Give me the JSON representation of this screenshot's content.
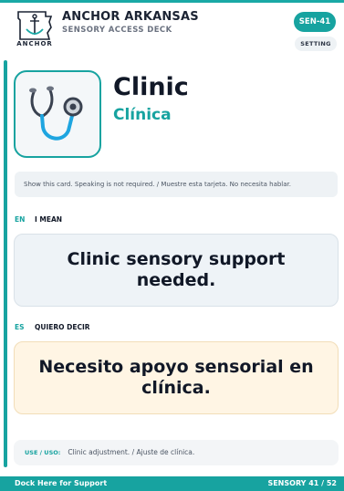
{
  "header": {
    "brand": "ANCHOR ARKANSAS",
    "subbrand": "SENSORY ACCESS DECK",
    "logo_text": "ANCHOR",
    "logo_icon": "arkansas-anchor-logo-icon",
    "card_code": "SEN-41",
    "category": "SETTING"
  },
  "hero": {
    "icon": "stethoscope-icon",
    "title_en": "Clinic",
    "title_es": "Clínica"
  },
  "note": "Show this card. Speaking is not required. / Muestre esta tarjeta. No necesita hablar.",
  "english": {
    "code": "EN",
    "label": "I MEAN",
    "text": "Clinic sensory support needed."
  },
  "spanish": {
    "code": "ES",
    "label": "QUIERO DECIR",
    "text": "Necesito apoyo sensorial en clínica."
  },
  "use": {
    "label": "USE / USO:",
    "text": "Clinic adjustment. / Ajuste de clínica."
  },
  "footer": {
    "left": "Dock Here for Support",
    "right": "SENSORY 41 / 52"
  },
  "colors": {
    "accent": "#17a3a0",
    "english_card": "#eef3f7",
    "spanish_card": "#fff5e4"
  }
}
